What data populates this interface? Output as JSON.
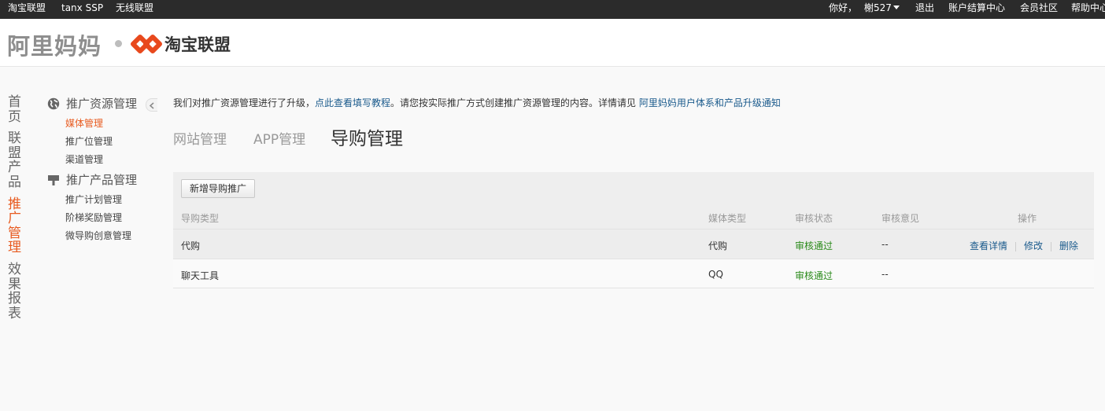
{
  "topbar": {
    "left_links": [
      "淘宝联盟",
      "tanx SSP",
      "无线联盟"
    ],
    "greeting": "你好，",
    "username": "榭527",
    "right_links": [
      "退出",
      "账户结算中心",
      "会员社区",
      "帮助中心"
    ]
  },
  "header": {
    "logo_alimama": "阿里妈妈",
    "logo_taobao": "淘宝联盟"
  },
  "vnav": {
    "items": [
      "首页",
      "联盟产品",
      "推广管理",
      "效果报表"
    ],
    "active": "推广管理"
  },
  "sidebar": {
    "groups": [
      {
        "title": "推广资源管理",
        "icon": "globe-icon",
        "links": [
          "媒体管理",
          "推广位管理",
          "渠道管理"
        ]
      },
      {
        "title": "推广产品管理",
        "icon": "signpost-icon",
        "links": [
          "推广计划管理",
          "阶梯奖励管理",
          "微导购创意管理"
        ]
      }
    ],
    "active_link": "媒体管理"
  },
  "notice": {
    "text1": "我们对推广资源管理进行了升级，",
    "link1": "点此查看填写教程",
    "text2": "。请您按实际推广方式创建推广资源管理的内容。详情请见 ",
    "link2": "阿里妈妈用户体系和产品升级通知"
  },
  "tabs": [
    "网站管理",
    "APP管理",
    "导购管理"
  ],
  "active_tab": "导购管理",
  "table": {
    "new_button": "新增导购推广",
    "headers": [
      "导购类型",
      "媒体类型",
      "审核状态",
      "审核意见",
      "操作"
    ],
    "rows": [
      {
        "type": "代购",
        "media": "代购",
        "status": "审核通过",
        "opinion": "--",
        "actions": [
          "查看详情",
          "修改",
          "删除"
        ]
      },
      {
        "type": "聊天工具",
        "media": "QQ",
        "status": "审核通过",
        "opinion": "--",
        "actions": []
      }
    ]
  },
  "colors": {
    "accent": "#e85b20",
    "link": "#1a5a8c",
    "success": "#2a8a1a",
    "topbar": "#2b2b2b"
  }
}
